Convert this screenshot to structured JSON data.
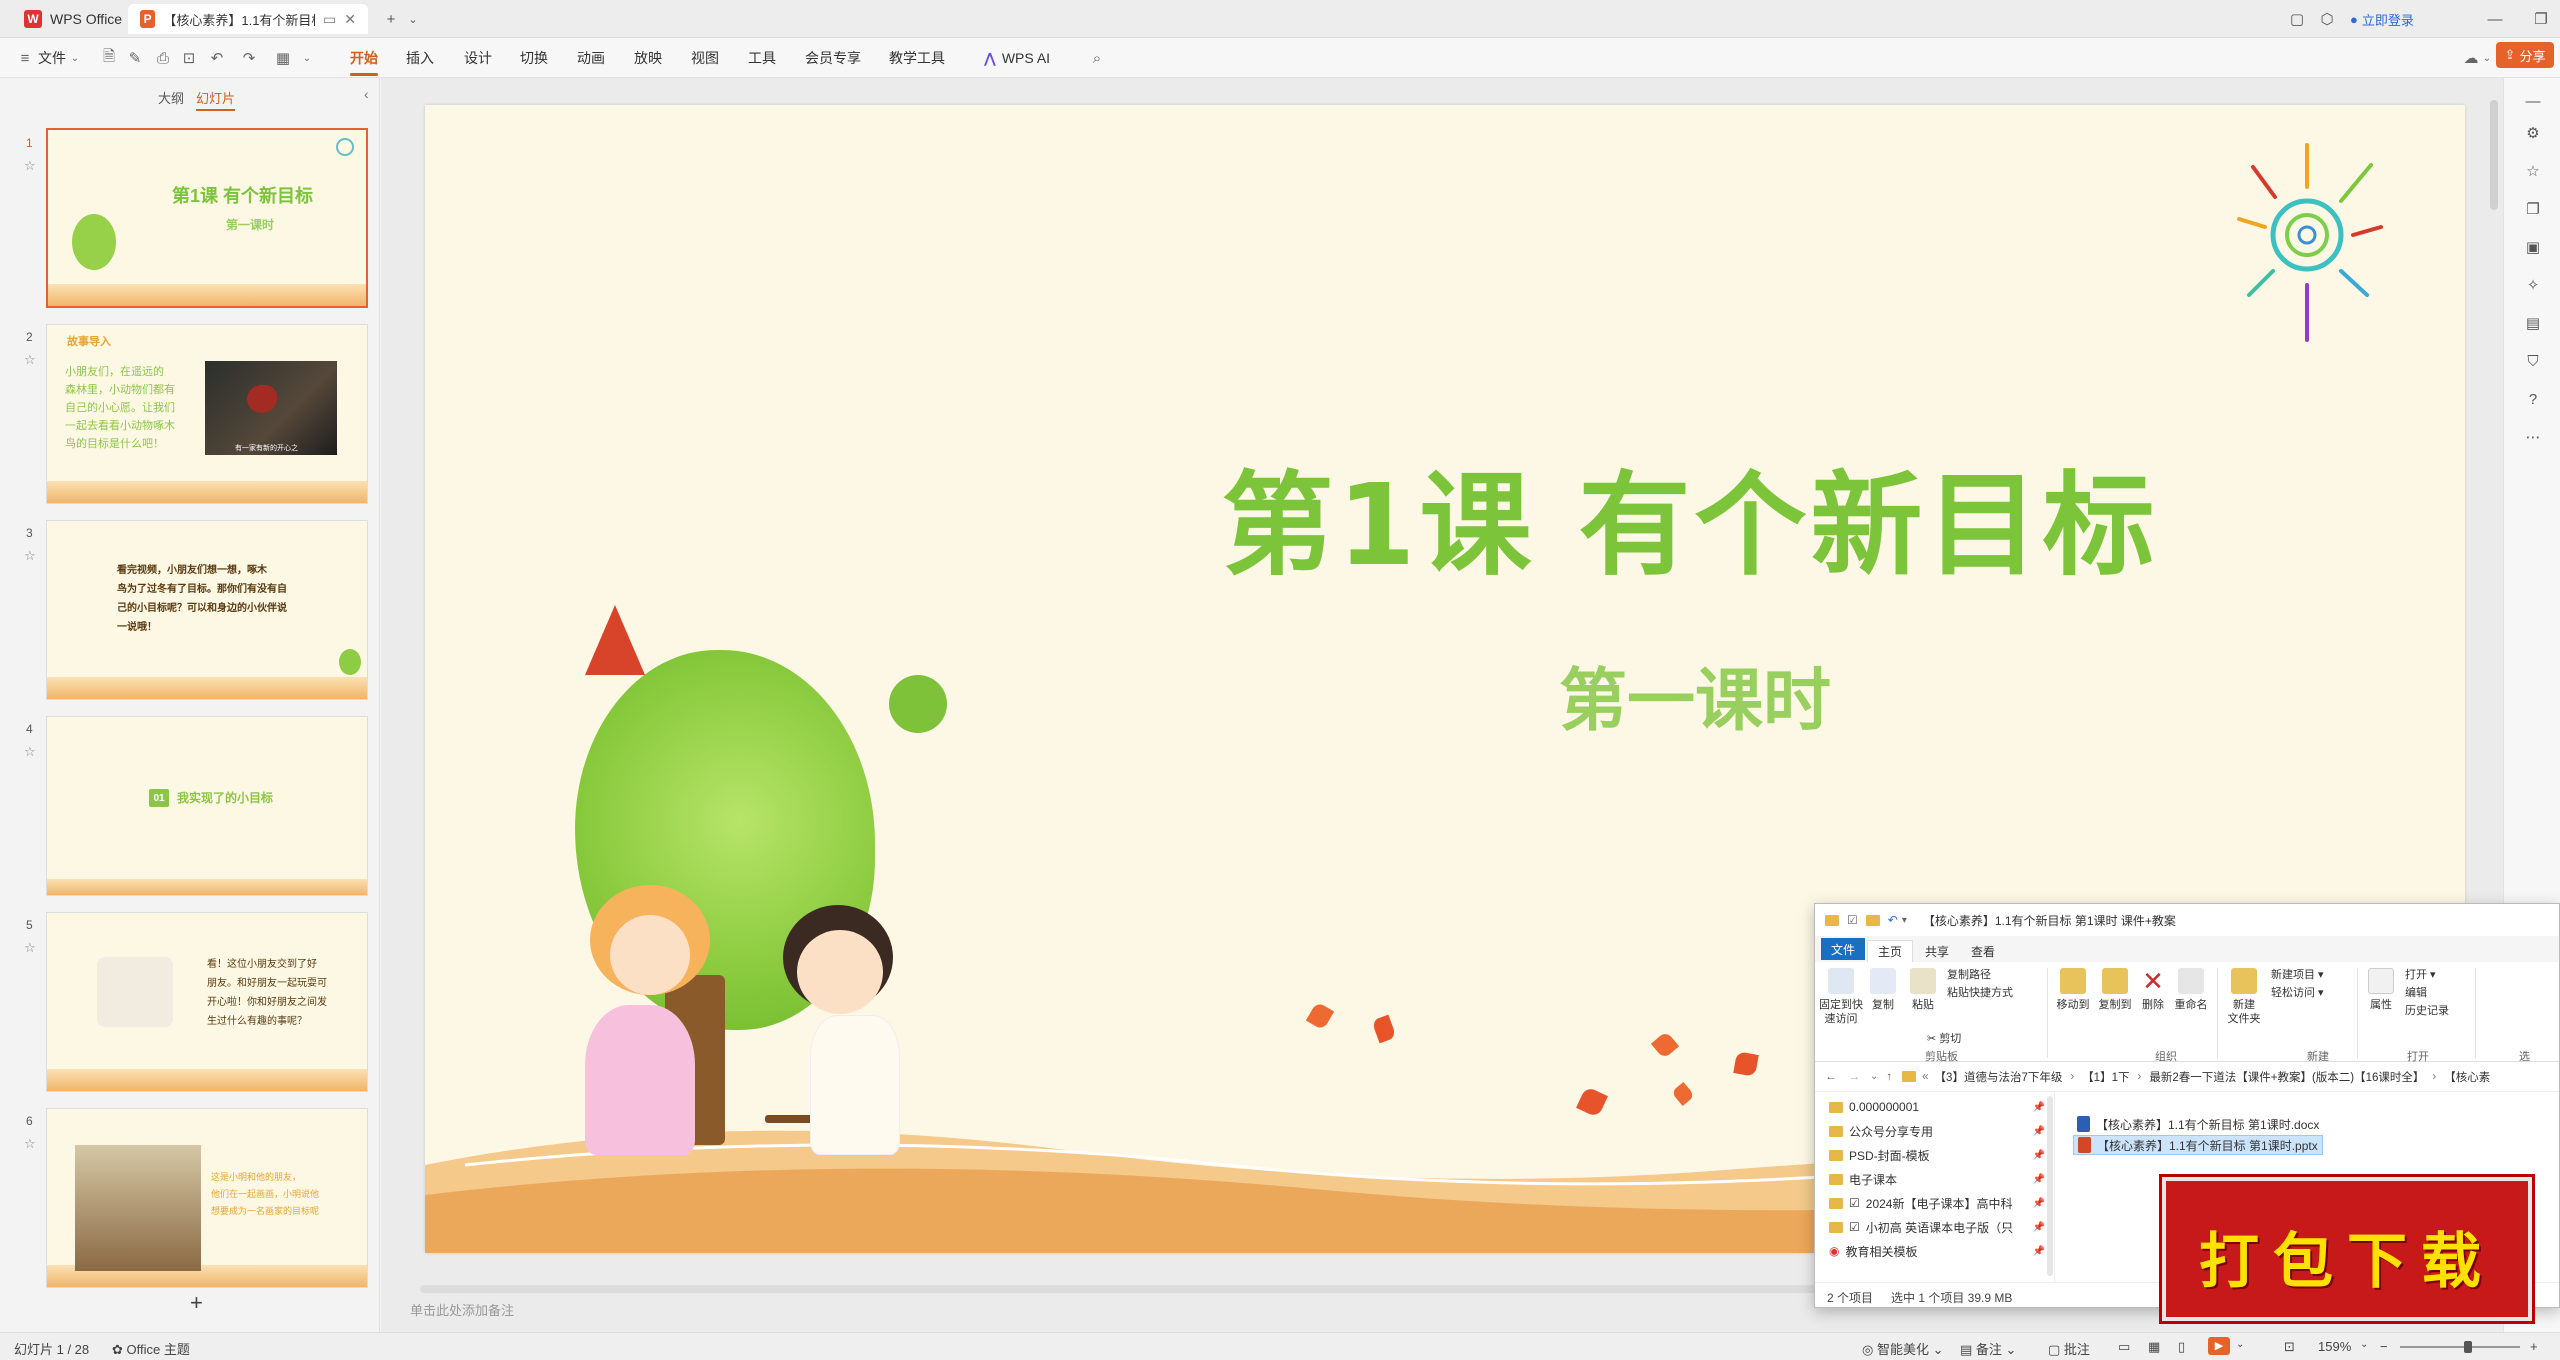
{
  "titlebar": {
    "app_tab": "WPS Office",
    "doc_tab": "【核心素养】1.1有个新目标 第",
    "login": "立即登录"
  },
  "menubar": {
    "file": "文件",
    "items": [
      "开始",
      "插入",
      "设计",
      "切换",
      "动画",
      "放映",
      "视图",
      "工具",
      "会员专享",
      "教学工具"
    ],
    "ai": "WPS AI",
    "share": "分享"
  },
  "leftpane": {
    "tab_outline": "大纲",
    "tab_slides": "幻灯片",
    "thumbs": [
      {
        "num": "1",
        "title": "第1课  有个新目标",
        "sub": "第一课时"
      },
      {
        "num": "2",
        "header": "故事导入",
        "text": "小朋友们，在遥远的\n森林里，小动物们都有\n自己的小心愿。让我们\n一起去看看小动物啄木\n鸟的目标是什么吧！",
        "caption": "有一家有新的开心之"
      },
      {
        "num": "3",
        "text": "看完视频，小朋友们想一想，啄木\n鸟为了过冬有了目标。那你们有没有自\n己的小目标呢？可以和身边的小伙伴说\n一说哦！"
      },
      {
        "num": "4",
        "badge": "01",
        "text": "我实现了的小目标"
      },
      {
        "num": "5",
        "text": "看！这位小朋友交到了好\n朋友。和好朋友一起玩耍可\n开心啦！你和好朋友之间发\n生过什么有趣的事呢？"
      },
      {
        "num": "6",
        "text": "这是小明和他的朋友，\n他们在一起画画，小明说他\n想要成为一名画家的目标呢"
      }
    ]
  },
  "slide": {
    "title": "第1课  有个新目标",
    "subtitle": "第一课时",
    "notes_placeholder": "单击此处添加备注"
  },
  "statusbar": {
    "slide_info": "幻灯片 1 / 28",
    "theme": "Office 主题",
    "smart": "智能美化",
    "notes": "备注",
    "comments": "批注",
    "zoom": "159%"
  },
  "explorer": {
    "title": "【核心素养】1.1有个新目标 第1课时 课件+教案",
    "tabs": [
      "文件",
      "主页",
      "共享",
      "查看"
    ],
    "ribbon": {
      "pin": "固定到快\n速访问",
      "copy": "复制",
      "paste": "粘贴",
      "copy_path": "复制路径",
      "paste_shortcut": "粘贴快捷方式",
      "cut": "剪切",
      "move_to": "移动到",
      "copy_to": "复制到",
      "delete": "删除",
      "rename": "重命名",
      "new_folder": "新建\n文件夹",
      "new_item": "新建项目",
      "easy_access": "轻松访问",
      "properties": "属性",
      "open": "打开",
      "edit": "编辑",
      "history": "历史记录",
      "group_clipboard": "剪贴板",
      "group_organize": "组织",
      "group_new": "新建",
      "group_open": "打开",
      "group_select": "选"
    },
    "address": {
      "seg1": "【3】道德与法治7下年级",
      "seg2": "【1】1下",
      "seg3": "最新2春一下道法【课件+教案】(版本二)【16课时全】",
      "seg4": "【核心素"
    },
    "nav": [
      "0.000000001",
      "公众号分享专用",
      "PSD-封面-模板",
      "电子课本",
      "2024新【电子课本】高中科",
      "小初高 英语课本电子版（只",
      "教育相关模板"
    ],
    "files": [
      "【核心素养】1.1有个新目标 第1课时.docx",
      "【核心素养】1.1有个新目标 第1课时.pptx"
    ],
    "status_count": "2 个项目",
    "status_selected": "选中 1 个项目  39.9 MB"
  },
  "banner": {
    "text": "打包下载"
  }
}
